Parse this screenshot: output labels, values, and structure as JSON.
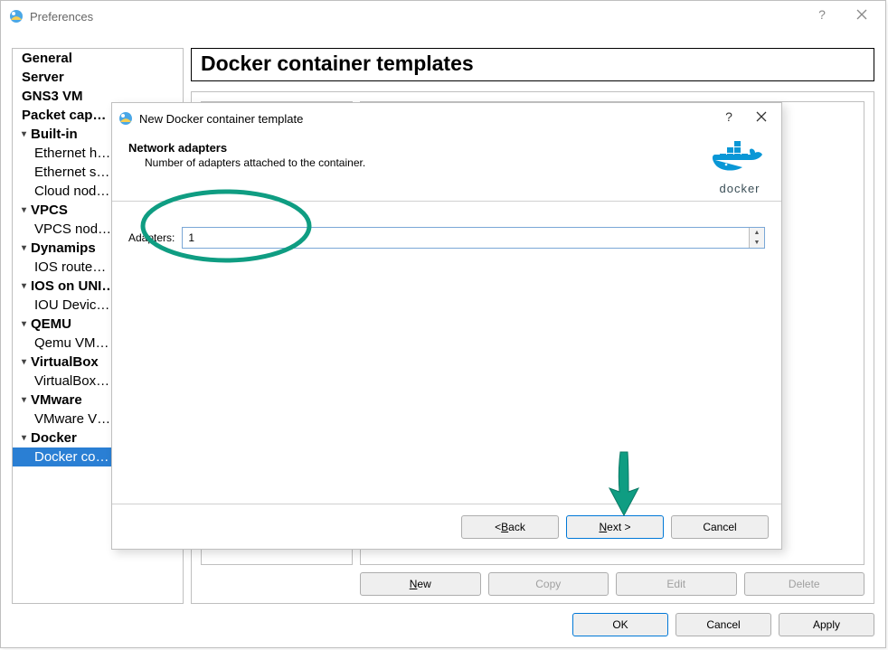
{
  "preferences": {
    "title": "Preferences",
    "header": "Docker container templates",
    "tree": {
      "general": "General",
      "server": "Server",
      "gns3vm": "GNS3 VM",
      "packet": "Packet cap…",
      "builtin": "Built-in",
      "eth_hubs": "Ethernet h…",
      "eth_sw": "Ethernet s…",
      "cloud": "Cloud nod…",
      "vpcs": "VPCS",
      "vpcs_nodes": "VPCS nod…",
      "dynamips": "Dynamips",
      "ios": "IOS route…",
      "iosunix": "IOS on UNI…",
      "iou": "IOU Devic…",
      "qemu": "QEMU",
      "qemuvm": "Qemu VM…",
      "vbox": "VirtualBox",
      "vboxvm": "VirtualBox…",
      "vmware": "VMware",
      "vmwarev": "VMware V…",
      "docker": "Docker",
      "dockerc": "Docker co…"
    },
    "buttons": {
      "new": "New",
      "copy": "Copy",
      "edit": "Edit",
      "delete": "Delete",
      "ok": "OK",
      "cancel": "Cancel",
      "apply": "Apply"
    }
  },
  "wizard": {
    "title": "New Docker container template",
    "heading": "Network adapters",
    "subheading": "Number of adapters attached to the container.",
    "adapters_label": "Adapters:",
    "adapters_value": "1",
    "docker_logo_text": "docker",
    "buttons": {
      "back": "< Back",
      "next": "Next >",
      "cancel": "Cancel"
    }
  }
}
